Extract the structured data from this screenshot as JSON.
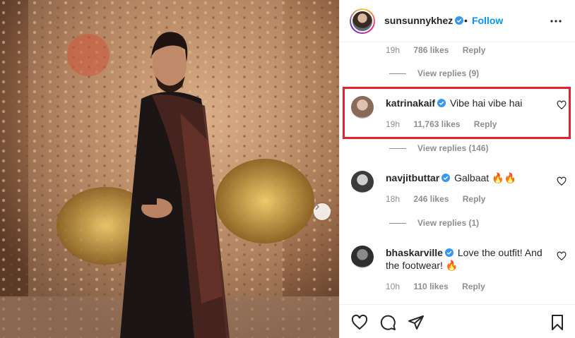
{
  "post": {
    "username": "sunsunnykhez",
    "follow_label": "Follow",
    "separator": "•"
  },
  "top_comment_meta": {
    "time": "19h",
    "likes": "786 likes",
    "reply": "Reply",
    "view_replies": "View replies (9)"
  },
  "comments": [
    {
      "username": "katrinakaif",
      "text": "Vibe hai vibe hai",
      "time": "19h",
      "likes": "11,763 likes",
      "reply": "Reply",
      "view_replies": "View replies (146)",
      "highlighted": true
    },
    {
      "username": "navjitbuttar",
      "text": "Galbaat 🔥🔥",
      "time": "18h",
      "likes": "246 likes",
      "reply": "Reply",
      "view_replies": "View replies (1)"
    },
    {
      "username": "bhaskarville",
      "text": "Love the outfit! And the footwear! 🔥",
      "time": "10h",
      "likes": "110 likes",
      "reply": "Reply"
    }
  ],
  "icons": {
    "verified": "verified-badge-icon",
    "more": "more-options-icon",
    "like": "heart-icon",
    "comment": "comment-icon",
    "share": "share-icon",
    "save": "bookmark-icon",
    "carousel_next": "chevron-right-icon"
  },
  "colors": {
    "accent": "#0095f6",
    "verified": "#3897f0",
    "highlight": "#e0242c",
    "muted_text": "#8e8e8e"
  }
}
